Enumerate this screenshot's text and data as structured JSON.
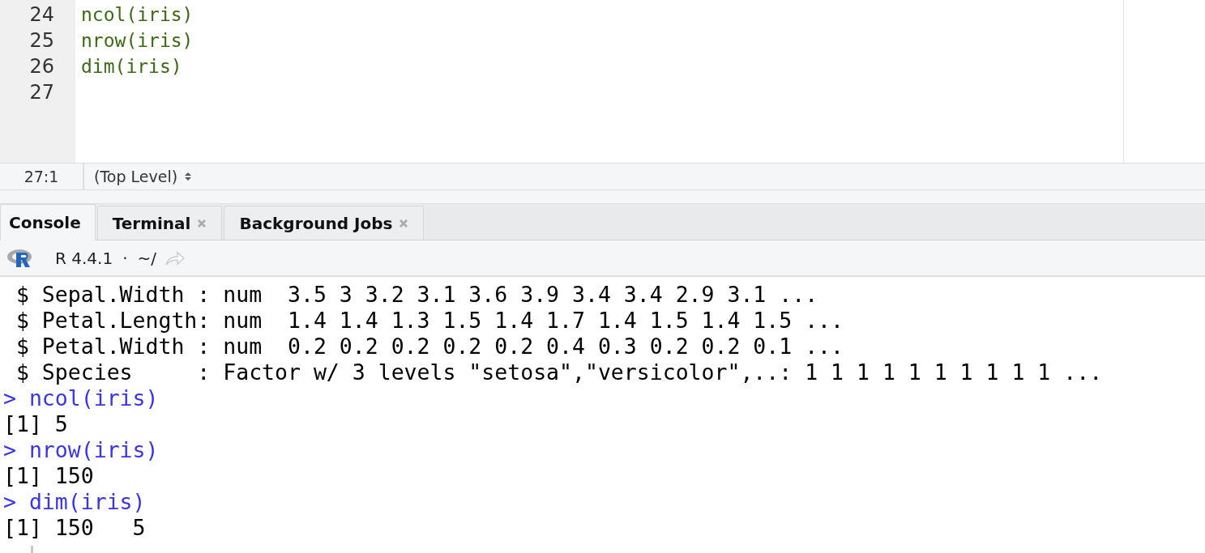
{
  "editor": {
    "lines": [
      {
        "number": "24",
        "code": "ncol(iris)"
      },
      {
        "number": "25",
        "code": "nrow(iris)"
      },
      {
        "number": "26",
        "code": "dim(iris)"
      },
      {
        "number": "27"
      }
    ]
  },
  "status_bar": {
    "position": "27:1",
    "scope": "(Top Level)"
  },
  "tabs": [
    {
      "label": "Console",
      "selected": true,
      "closable": false
    },
    {
      "label": "Terminal",
      "selected": false,
      "closable": true
    },
    {
      "label": "Background Jobs",
      "selected": false,
      "closable": true
    }
  ],
  "console_toolbar": {
    "version": "R 4.4.1",
    "separator": "·",
    "path": "~/"
  },
  "console": {
    "lines": [
      {
        "kind": "output",
        "text": " $ Sepal.Width : num  3.5 3 3.2 3.1 3.6 3.9 3.4 3.4 2.9 3.1 ..."
      },
      {
        "kind": "output",
        "text": " $ Petal.Length: num  1.4 1.4 1.3 1.5 1.4 1.7 1.4 1.5 1.4 1.5 ..."
      },
      {
        "kind": "output",
        "text": " $ Petal.Width : num  0.2 0.2 0.2 0.2 0.2 0.4 0.3 0.2 0.2 0.1 ..."
      },
      {
        "kind": "output",
        "text": " $ Species     : Factor w/ 3 levels \"setosa\",\"versicolor\",..: 1 1 1 1 1 1 1 1 1 1 ..."
      },
      {
        "kind": "command",
        "prompt": ">",
        "text": "ncol(iris)"
      },
      {
        "kind": "output",
        "text": "[1] 5"
      },
      {
        "kind": "command",
        "prompt": ">",
        "text": "nrow(iris)"
      },
      {
        "kind": "output",
        "text": "[1] 150"
      },
      {
        "kind": "command",
        "prompt": ">",
        "text": "dim(iris)"
      },
      {
        "kind": "output",
        "text": "[1] 150   5"
      }
    ]
  }
}
